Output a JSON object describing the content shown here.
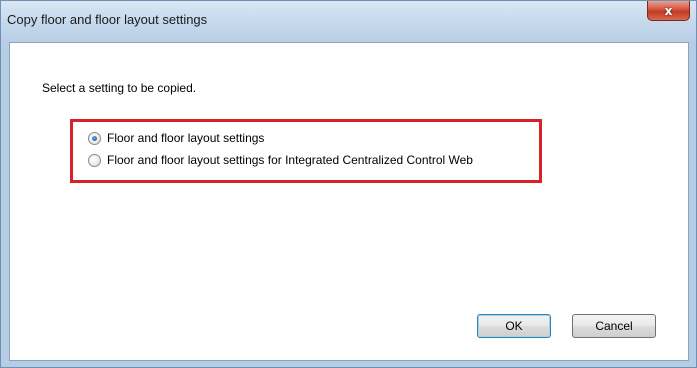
{
  "dialog": {
    "title": "Copy floor and floor layout settings",
    "close_glyph": "x"
  },
  "content": {
    "prompt": "Select a setting to be copied.",
    "options": [
      {
        "label": "Floor and floor layout settings",
        "selected": true
      },
      {
        "label": "Floor and floor layout settings for Integrated Centralized Control Web",
        "selected": false
      }
    ],
    "highlight_color": "#d8222a"
  },
  "buttons": {
    "ok_label": "OK",
    "cancel_label": "Cancel"
  }
}
